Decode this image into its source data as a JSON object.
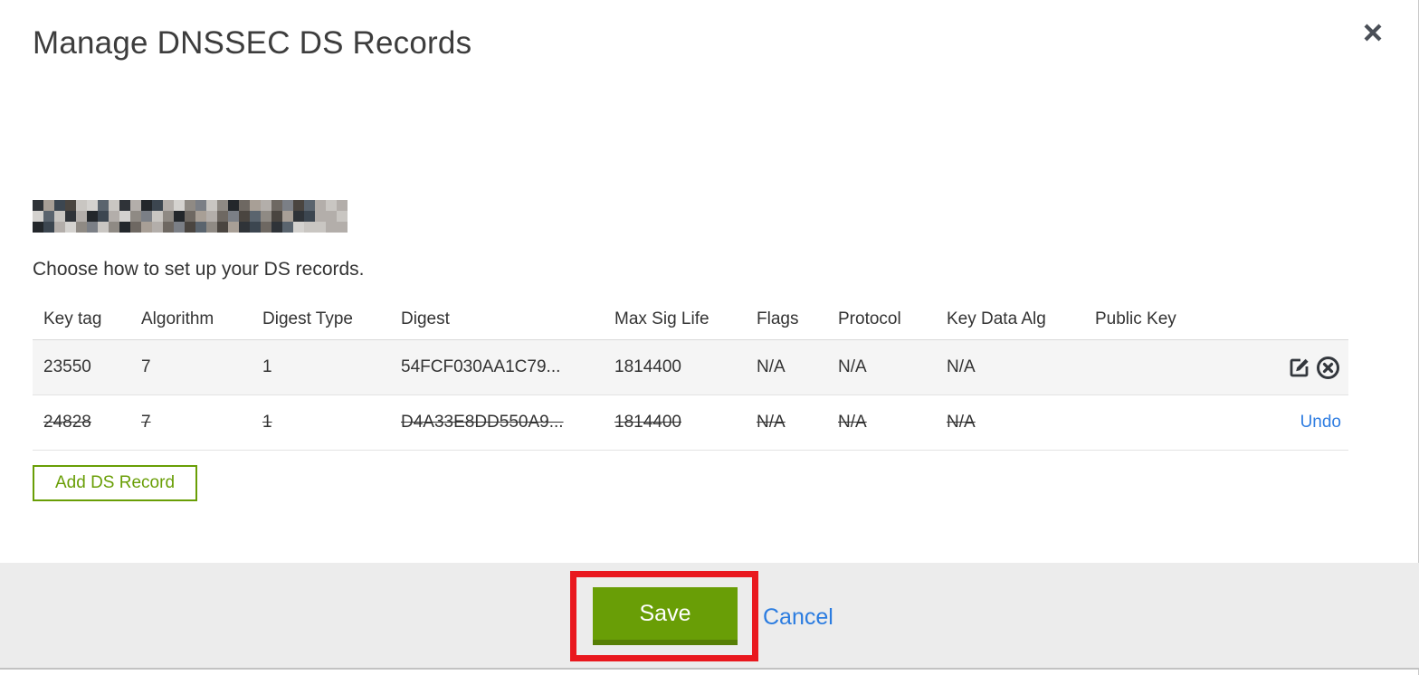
{
  "modal": {
    "title": "Manage DNSSEC DS Records"
  },
  "domain": {
    "redacted": true
  },
  "instruction": "Choose how to set up your DS records.",
  "table": {
    "columns": [
      "Key tag",
      "Algorithm",
      "Digest Type",
      "Digest",
      "Max Sig Life",
      "Flags",
      "Protocol",
      "Key Data Alg",
      "Public Key"
    ],
    "rows": [
      {
        "key_tag": "23550",
        "algorithm": "7",
        "digest_type": "1",
        "digest": "54FCF030AA1C79...",
        "max_sig_life": "1814400",
        "flags": "N/A",
        "protocol": "N/A",
        "key_data_alg": "N/A",
        "public_key": "",
        "deleted": false,
        "actions": [
          "edit",
          "remove"
        ]
      },
      {
        "key_tag": "24828",
        "algorithm": "7",
        "digest_type": "1",
        "digest": "D4A33E8DD550A9...",
        "max_sig_life": "1814400",
        "flags": "N/A",
        "protocol": "N/A",
        "key_data_alg": "N/A",
        "public_key": "",
        "deleted": true,
        "undo_label": "Undo"
      }
    ]
  },
  "buttons": {
    "add_ds_record": "Add DS Record",
    "save": "Save",
    "cancel": "Cancel"
  },
  "icons": {
    "close": "x-cross",
    "edit": "pencil-square",
    "remove": "circle-x"
  },
  "colors": {
    "green": "#699e06",
    "green_dark": "#567f05",
    "blue_link": "#2b7ce0",
    "red_annotation": "#e9181e",
    "footer_bg": "#ececec",
    "row_shaded_bg": "#f5f5f5",
    "text": "#333333"
  }
}
